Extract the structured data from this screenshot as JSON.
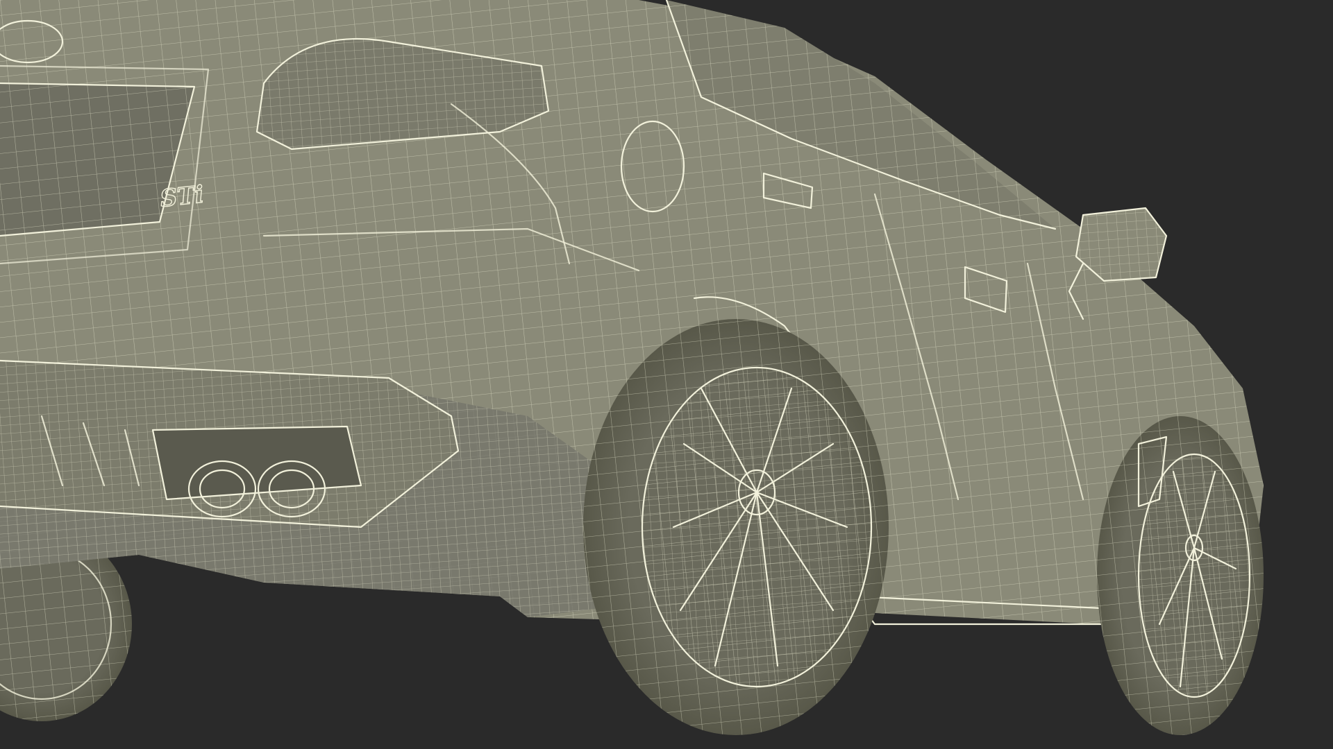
{
  "scene": {
    "subject": "car-rear-three-quarter-wireframe",
    "background_color": "#2a2a2a",
    "body_color": "#8a8a78",
    "body_shade_color": "#6e6e60",
    "dark_shade_color": "#4c4c43",
    "wire_color": "#e9e8cf"
  },
  "badges": {
    "trunk_badge": "STi"
  }
}
